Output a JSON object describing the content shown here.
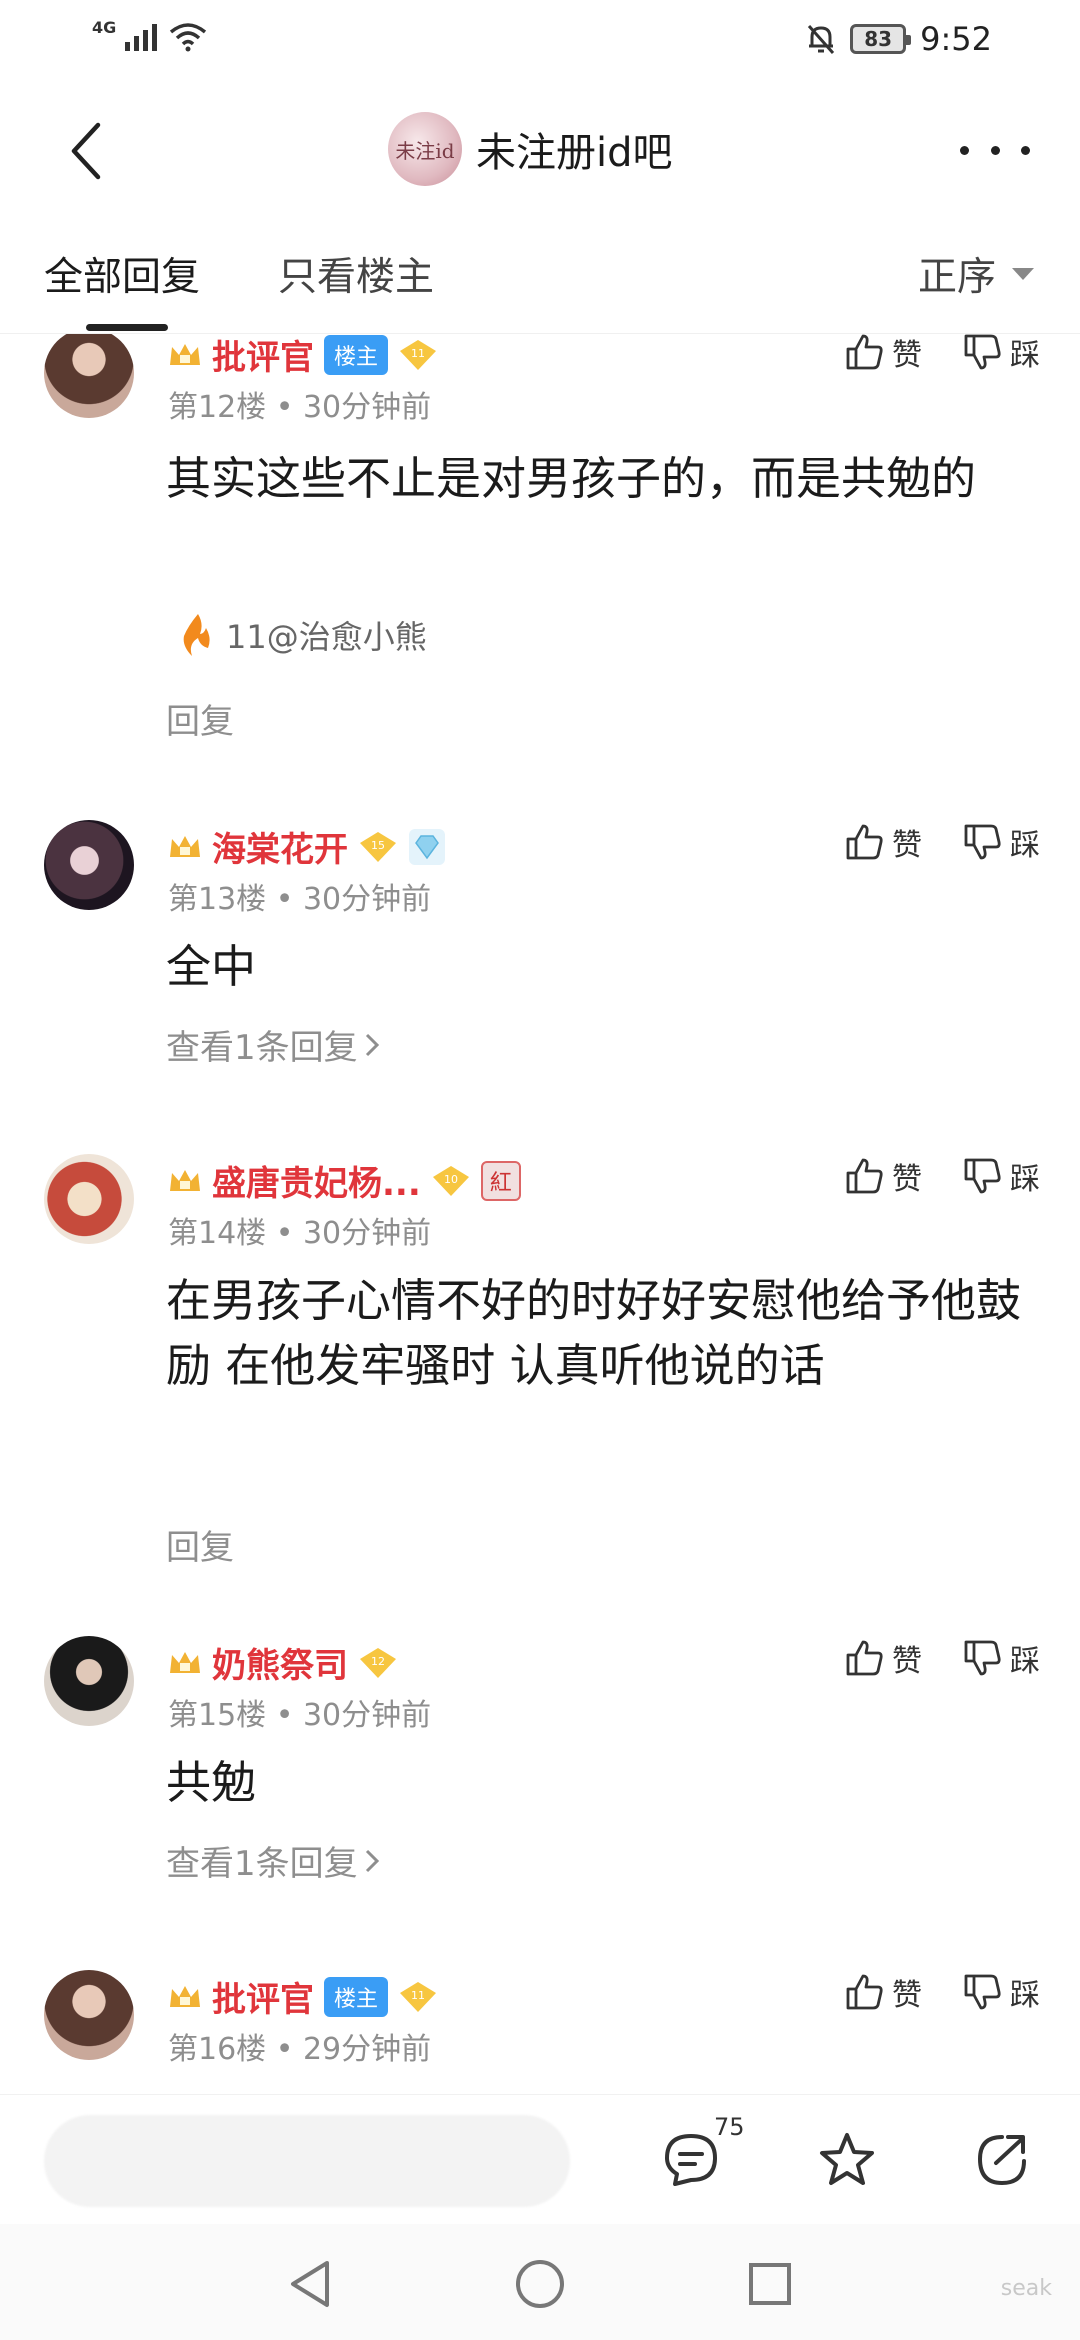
{
  "status_bar": {
    "network": "4G",
    "battery": "83",
    "time": "9:52"
  },
  "header": {
    "forum_title": "未注册id吧",
    "forum_avatar_text": "未注id"
  },
  "tabs": {
    "all": "全部回复",
    "op_only": "只看楼主",
    "sort": "正序"
  },
  "actions": {
    "like": "赞",
    "dislike": "踩"
  },
  "posts": [
    {
      "username": "批评官",
      "op_badge": "楼主",
      "level": "11",
      "floor": "第12楼",
      "time": "30分钟前",
      "content": "其实这些不止是对男孩子的，而是共勉的",
      "tail": "11@治愈小熊",
      "reply_label": "回复"
    },
    {
      "username": "海棠花开",
      "level": "15",
      "floor": "第13楼",
      "time": "30分钟前",
      "content": "全中",
      "view_replies": "查看1条回复"
    },
    {
      "username": "盛唐贵妃杨...",
      "level": "10",
      "hong_badge": "紅",
      "floor": "第14楼",
      "time": "30分钟前",
      "content": "在男孩子心情不好的时好好安慰他给予他鼓励 在他发牢骚时 认真听他说的话",
      "reply_label": "回复"
    },
    {
      "username": "奶熊祭司",
      "level": "12",
      "floor": "第15楼",
      "time": "30分钟前",
      "content": "共勉",
      "view_replies": "查看1条回复"
    },
    {
      "username": "批评官",
      "op_badge": "楼主",
      "level": "11",
      "floor": "第16楼",
      "time": "29分钟前"
    }
  ],
  "bottom_bar": {
    "comment_count": "75"
  },
  "watermark": "seak",
  "colors": {
    "username_red": "#e0353b",
    "op_badge_blue": "#3a9df5",
    "meta_gray": "#8e8e8e"
  }
}
